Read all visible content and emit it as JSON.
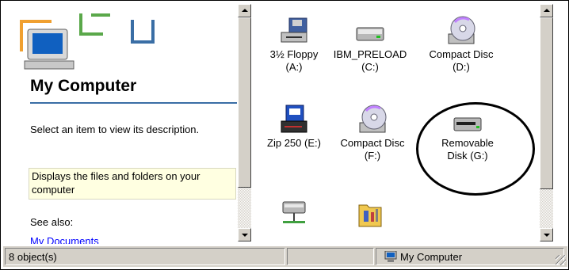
{
  "left_pane": {
    "title": "My Computer",
    "description": "Select an item to view its description.",
    "info": "Displays the files and folders on your computer",
    "see_also": "See also:",
    "link_my_documents": "My Documents"
  },
  "items": [
    {
      "label": "3½ Floppy\n(A:)",
      "icon": "floppy-drive-icon"
    },
    {
      "label": "IBM_PRELOAD\n(C:)",
      "icon": "hard-drive-icon"
    },
    {
      "label": "Compact Disc\n(D:)",
      "icon": "cd-drive-icon"
    },
    {
      "label": "Zip 250 (E:)",
      "icon": "zip-drive-icon"
    },
    {
      "label": "Compact Disc\n(F:)",
      "icon": "cd-drive-icon"
    },
    {
      "label": "Removable\nDisk (G:)",
      "icon": "removable-disk-icon"
    },
    {
      "label": "",
      "icon": "network-drive-icon"
    },
    {
      "label": "",
      "icon": "control-panel-folder-icon"
    }
  ],
  "status_bar": {
    "object_count": "8 object(s)",
    "location": "My Computer",
    "location_icon": "computer-icon"
  },
  "colors": {
    "title_rule": "#3a6ea5",
    "info_bg": "#ffffe1",
    "link": "#0000ff",
    "chrome": "#d4d0c8"
  }
}
